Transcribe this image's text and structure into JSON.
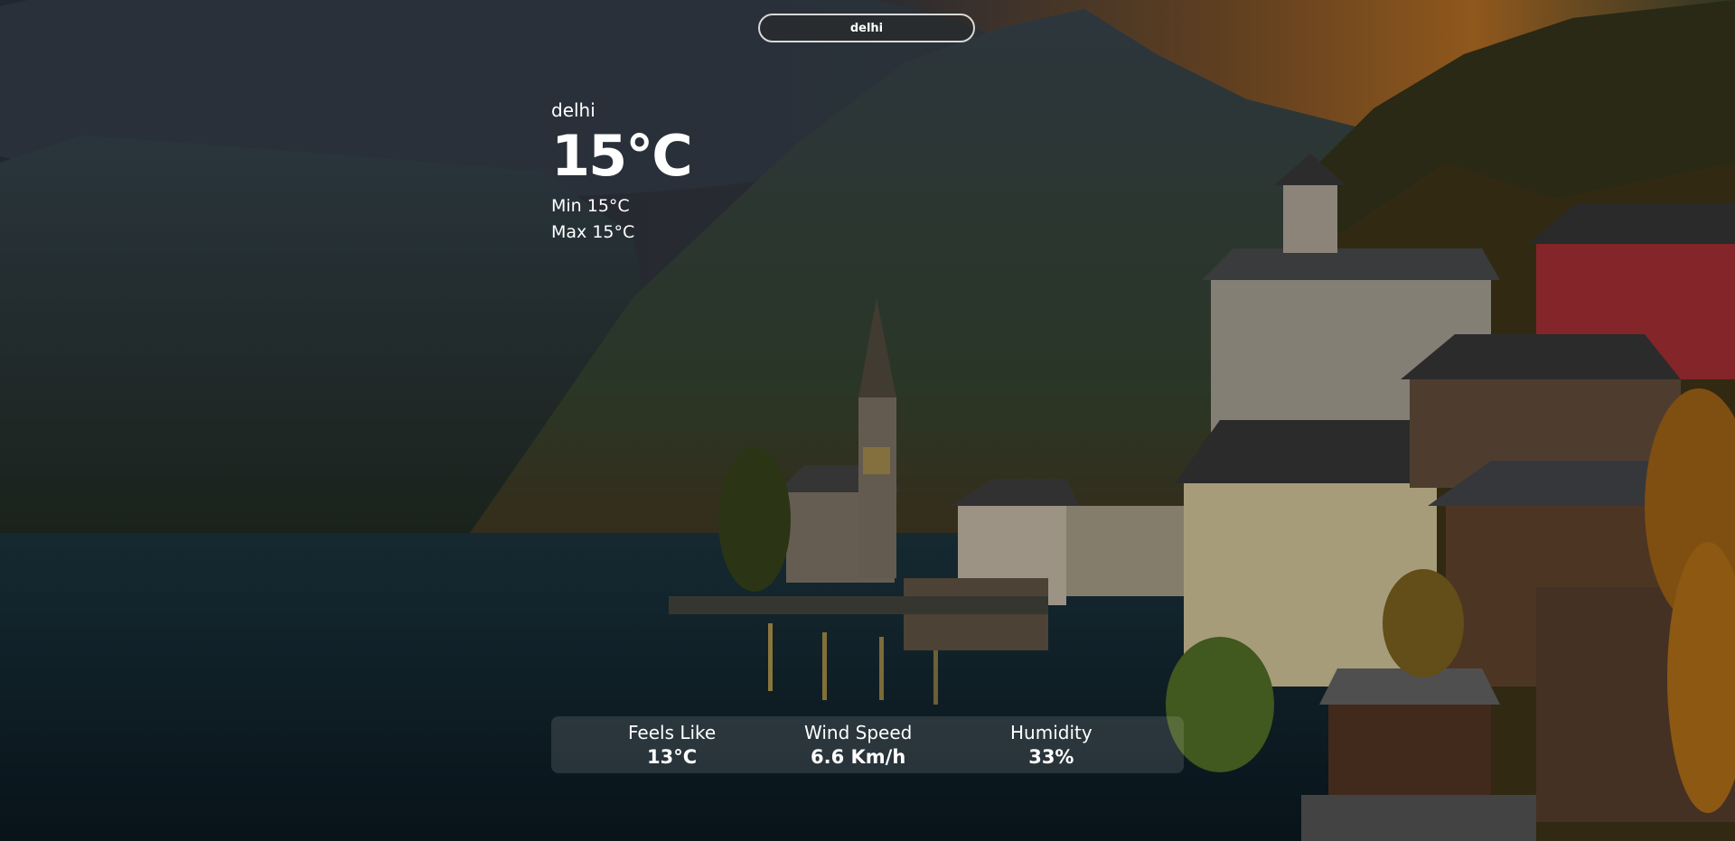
{
  "search": {
    "value": "delhi",
    "placeholder": ""
  },
  "current": {
    "city": "delhi",
    "temperature": "15°C",
    "min": "Min 15°C",
    "max": "Max 15°C"
  },
  "details": [
    {
      "label": "Feels Like",
      "value": "13°C"
    },
    {
      "label": "Wind Speed",
      "value": "6.6 Km/h"
    },
    {
      "label": "Humidity",
      "value": "33%"
    }
  ]
}
